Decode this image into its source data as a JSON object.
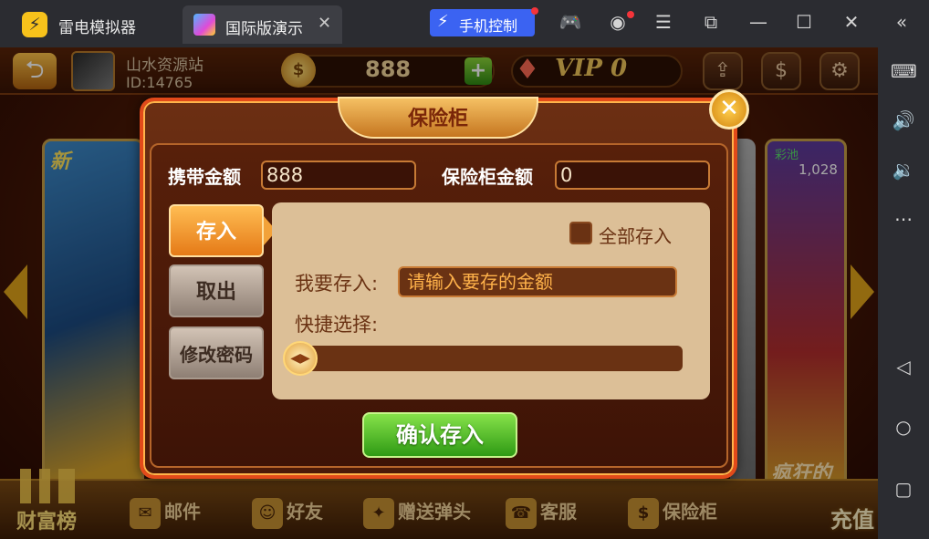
{
  "titlebar": {
    "brand": "雷电模拟器",
    "tab_label": "国际版演示",
    "tab_close": "✕",
    "phone_control": "手机控制"
  },
  "sidebar": {
    "icons": [
      "keyboard-icon",
      "volume-up-icon",
      "volume-down-icon",
      "more-icon",
      "back-icon",
      "home-icon",
      "recents-icon"
    ]
  },
  "game": {
    "username": "山水资源站",
    "user_id": "ID:14765",
    "gold": "888",
    "vip": "VIP 0",
    "card_left_badge": "新",
    "card_right_top": "彩池",
    "card_right_num": "1,028",
    "card_right_bottom": "疯狂的",
    "bottom": {
      "wealth": "财富榜",
      "mail": "邮件",
      "friends": "好友",
      "gift": "赠送弹头",
      "service": "客服",
      "vault": "保险柜",
      "recharge": "充值"
    }
  },
  "dialog": {
    "title": "保险柜",
    "close": "✕",
    "carry_label": "携带金额",
    "carry_value": "888",
    "safe_label": "保险柜金额",
    "safe_value": "0",
    "tabs": {
      "deposit": "存入",
      "withdraw": "取出",
      "change_password": "修改密码"
    },
    "deposit_all": "全部存入",
    "deposit_label": "我要存入:",
    "deposit_placeholder": "请输入要存的金额",
    "quick_label": "快捷选择:",
    "confirm": "确认存入"
  }
}
